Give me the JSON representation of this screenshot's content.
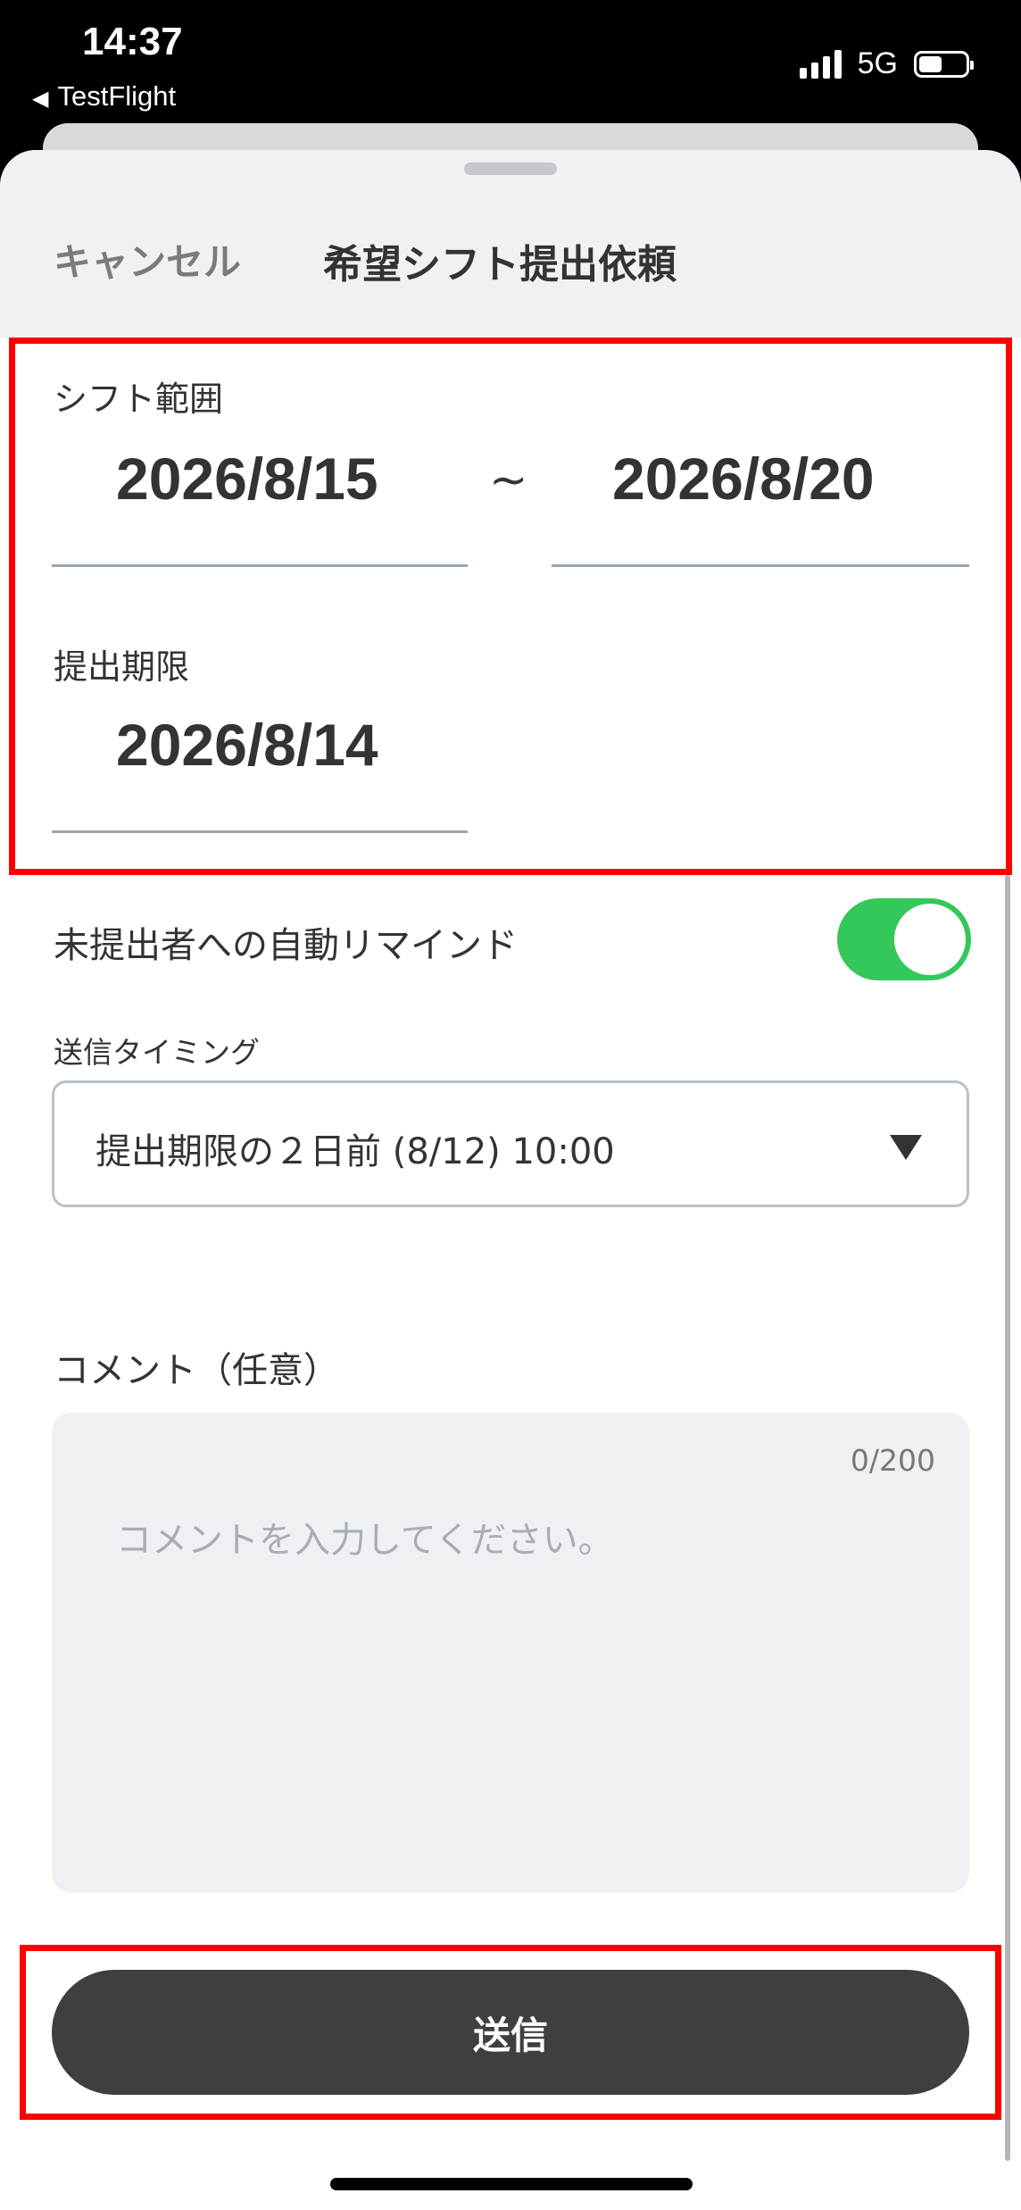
{
  "status_bar": {
    "time": "14:37",
    "back_app": "TestFlight",
    "network": "5G",
    "battery_level": 0.5
  },
  "header": {
    "cancel_label": "キャンセル",
    "title": "希望シフト提出依頼"
  },
  "form": {
    "shift_range": {
      "label": "シフト範囲",
      "start": "2026/8/15",
      "separator": "~",
      "end": "2026/8/20"
    },
    "deadline": {
      "label": "提出期限",
      "value": "2026/8/14"
    },
    "auto_remind": {
      "label": "未提出者への自動リマインド",
      "enabled": true
    },
    "timing": {
      "label": "送信タイミング",
      "selected": "提出期限の２日前 (8/12) 10:00"
    },
    "comment": {
      "label": "コメント（任意）",
      "counter": "0/200",
      "placeholder": "コメントを入力してください。"
    }
  },
  "submit_label": "送信",
  "colors": {
    "highlight": "#ff0000",
    "toggle_on": "#34c759",
    "submit_bg": "#3f3f3f"
  }
}
